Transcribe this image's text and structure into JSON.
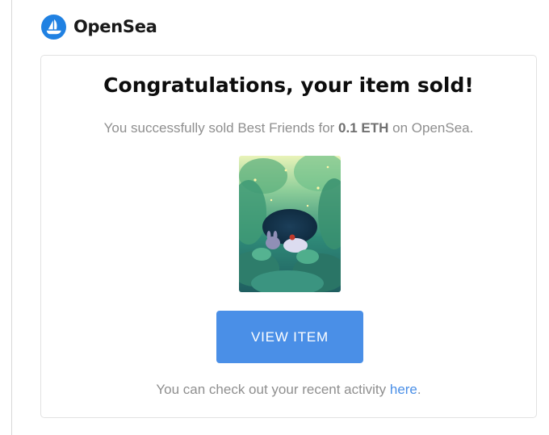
{
  "brand": {
    "name": "OpenSea",
    "accent_color": "#2081e2",
    "logo_icon": "sailboat-logo-icon"
  },
  "card": {
    "headline": "Congratulations, your item sold!",
    "message": {
      "prefix": "You successfully sold Best Friends for",
      "amount": "0.1 ETH",
      "suffix": "on OpenSea."
    },
    "item_image": {
      "icon": "nft-artwork-forest-scene"
    },
    "button_label": "VIEW ITEM",
    "button_color": "#4a8fe7",
    "footer": {
      "prefix": "You can check out your recent activity",
      "link_text": "here",
      "suffix": "."
    }
  }
}
